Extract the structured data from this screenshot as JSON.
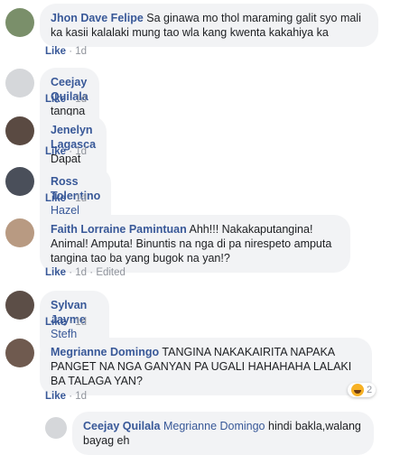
{
  "comments": [
    {
      "name": "Jhon Dave Felipe",
      "text": "Sa ginawa mo thol maraming galit syo mali ka kasii kalalaki mung tao wla kang kwenta kakahiya ka",
      "like": "Like",
      "time": "1d"
    },
    {
      "name": "Ceejay Quilala",
      "text": "tangna walang bayag amputa",
      "like": "Like",
      "time": "1d"
    },
    {
      "name": "Jenelyn Lagasca",
      "text": "Dapat sayo putulan ka nang bayag. Gago!",
      "like": "Like",
      "time": "1d",
      "emoji_icon": "raised-hand-icon"
    },
    {
      "name": "Ross Tolentino",
      "mention": "Hazel Lapuz",
      "like": "Like",
      "time": "1d"
    },
    {
      "name": "Faith Lorraine Pamintuan",
      "text": "Ahh!!! Nakakaputangina! Animal! Amputa! Binuntis na nga di pa nirespeto amputa tangina tao ba yang bugok na yan!?",
      "like": "Like",
      "time": "1d",
      "edited": "Edited"
    },
    {
      "name": "Sylvan Jayme",
      "mention": "Stefh Gonzales",
      "like": "Like",
      "time": "1d"
    },
    {
      "name": "Megrianne Domingo",
      "text": "TANGINA NAKAKAIRITA NAPAKA PANGET NA NGA GANYAN PA UGALI HAHAHAHA LALAKI BA TALAGA YAN?",
      "like": "Like",
      "time": "1d",
      "reaction_icon": "haha-reaction-icon",
      "reaction_count": "2"
    }
  ],
  "reply": {
    "name": "Ceejay Quilala",
    "mention": "Megrianne Domingo",
    "text": "hindi bakla,walang bayag eh"
  },
  "separator": "·",
  "colors": {
    "name": "#385898",
    "bubble": "#f2f3f5",
    "meta": "#90949c"
  }
}
